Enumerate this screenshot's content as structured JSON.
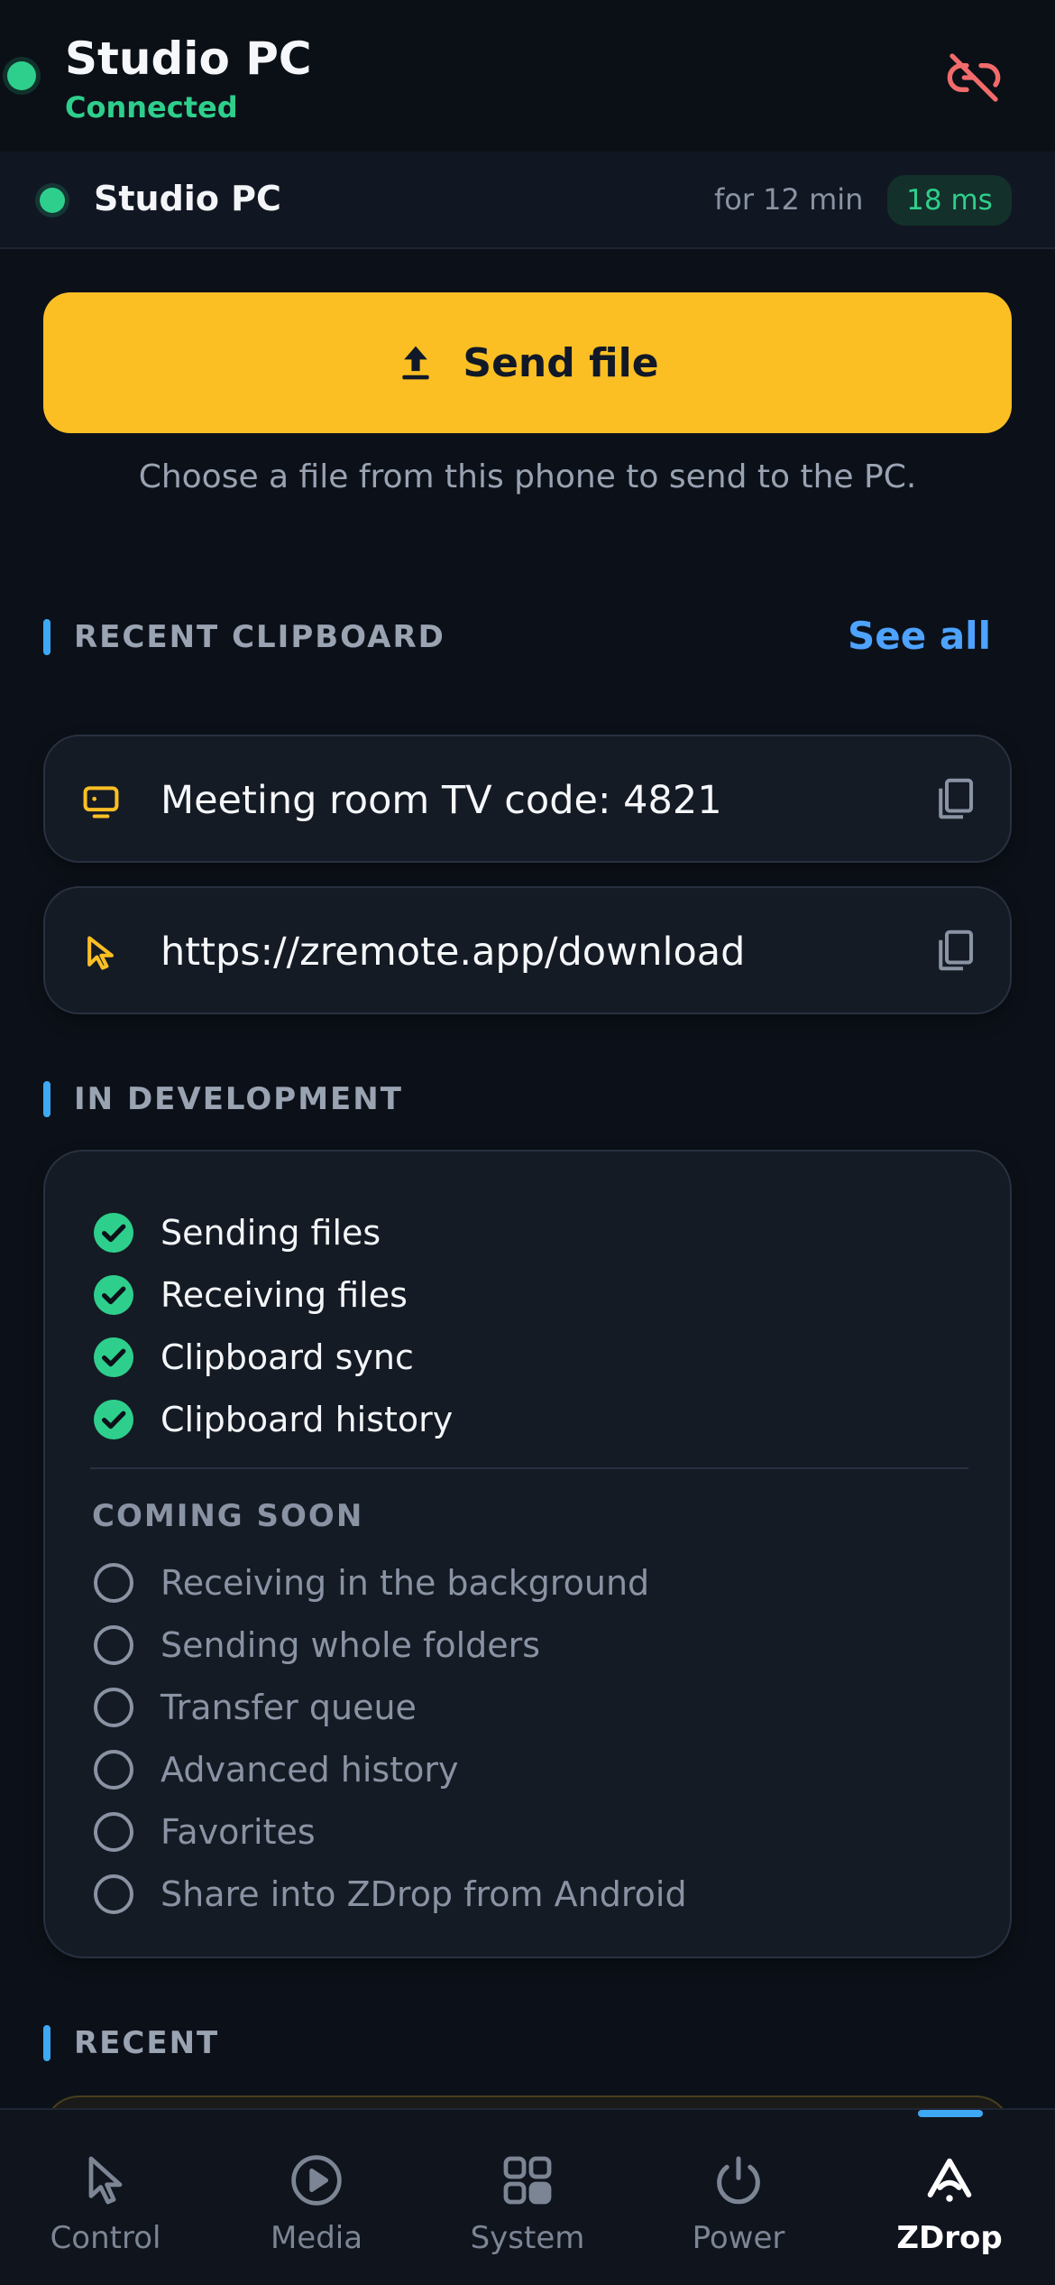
{
  "header": {
    "title": "Studio PC",
    "status": "Connected",
    "disconnect_icon": "unlink-icon"
  },
  "connection": {
    "device_name": "Studio PC",
    "duration": "for 12 min",
    "latency": "18 ms"
  },
  "send_file": {
    "label": "Send file",
    "hint": "Choose a file from this phone to send to the PC."
  },
  "recent_clipboard": {
    "title": "RECENT CLIPBOARD",
    "see_all": "See all",
    "items": [
      {
        "text": "Meeting room TV code: 4821",
        "icon": "monitor-icon"
      },
      {
        "text": "https://zremote.app/download",
        "icon": "cursor-icon"
      }
    ]
  },
  "in_development": {
    "title": "IN DEVELOPMENT",
    "done": [
      "Sending files",
      "Receiving files",
      "Clipboard sync",
      "Clipboard history"
    ],
    "coming_soon_title": "COMING SOON",
    "coming_soon": [
      "Receiving in the background",
      "Sending whole folders",
      "Transfer queue",
      "Advanced history",
      "Favorites",
      "Share into ZDrop from Android"
    ]
  },
  "recent": {
    "title": "RECENT"
  },
  "nav": {
    "items": [
      {
        "label": "Control",
        "icon": "cursor-icon"
      },
      {
        "label": "Media",
        "icon": "play-icon"
      },
      {
        "label": "System",
        "icon": "grid-icon"
      },
      {
        "label": "Power",
        "icon": "power-icon"
      },
      {
        "label": "ZDrop",
        "icon": "zdrop-icon"
      }
    ],
    "active": "ZDrop"
  },
  "colors": {
    "accent": "#fbbf24",
    "connected": "#2ecf8c",
    "link": "#4da3ff",
    "danger": "#f26b6b",
    "section_bar": "#3ea8f5"
  }
}
